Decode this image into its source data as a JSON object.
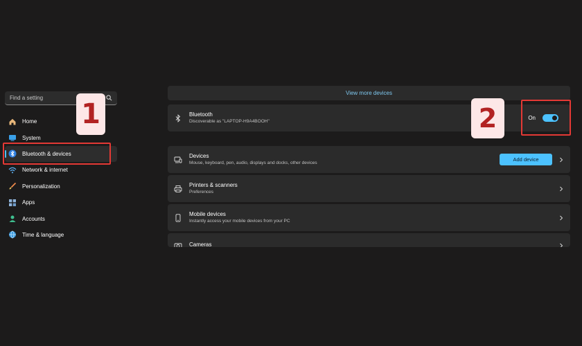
{
  "sidebar": {
    "search_placeholder": "Find a setting",
    "items": [
      {
        "label": "Home",
        "icon": "home-icon"
      },
      {
        "label": "System",
        "icon": "system-icon"
      },
      {
        "label": "Bluetooth & devices",
        "icon": "bluetooth-icon",
        "active": true
      },
      {
        "label": "Network & internet",
        "icon": "wifi-icon"
      },
      {
        "label": "Personalization",
        "icon": "brush-icon"
      },
      {
        "label": "Apps",
        "icon": "apps-icon"
      },
      {
        "label": "Accounts",
        "icon": "person-icon"
      },
      {
        "label": "Time & language",
        "icon": "globe-icon"
      }
    ]
  },
  "main": {
    "view_more": "View more devices",
    "bluetooth": {
      "title": "Bluetooth",
      "subtitle": "Discoverable as \"LAPTOP-H9A4BOOH\"",
      "toggle_label": "On",
      "toggle_on": true
    },
    "rows": [
      {
        "title": "Devices",
        "subtitle": "Mouse, keyboard, pen, audio, displays and docks, other devices",
        "button": "Add device"
      },
      {
        "title": "Printers & scanners",
        "subtitle": "Preferences"
      },
      {
        "title": "Mobile devices",
        "subtitle": "Instantly access your mobile devices from your PC"
      },
      {
        "title": "Cameras",
        "subtitle": ""
      }
    ]
  },
  "annotations": {
    "step1": "1",
    "step2": "2"
  },
  "colors": {
    "background": "#1c1b1b",
    "card": "#2b2b2b",
    "accent": "#4cc2ff",
    "highlight": "#e53935",
    "badge_bg": "#fde7e7",
    "badge_text": "#b22222"
  }
}
